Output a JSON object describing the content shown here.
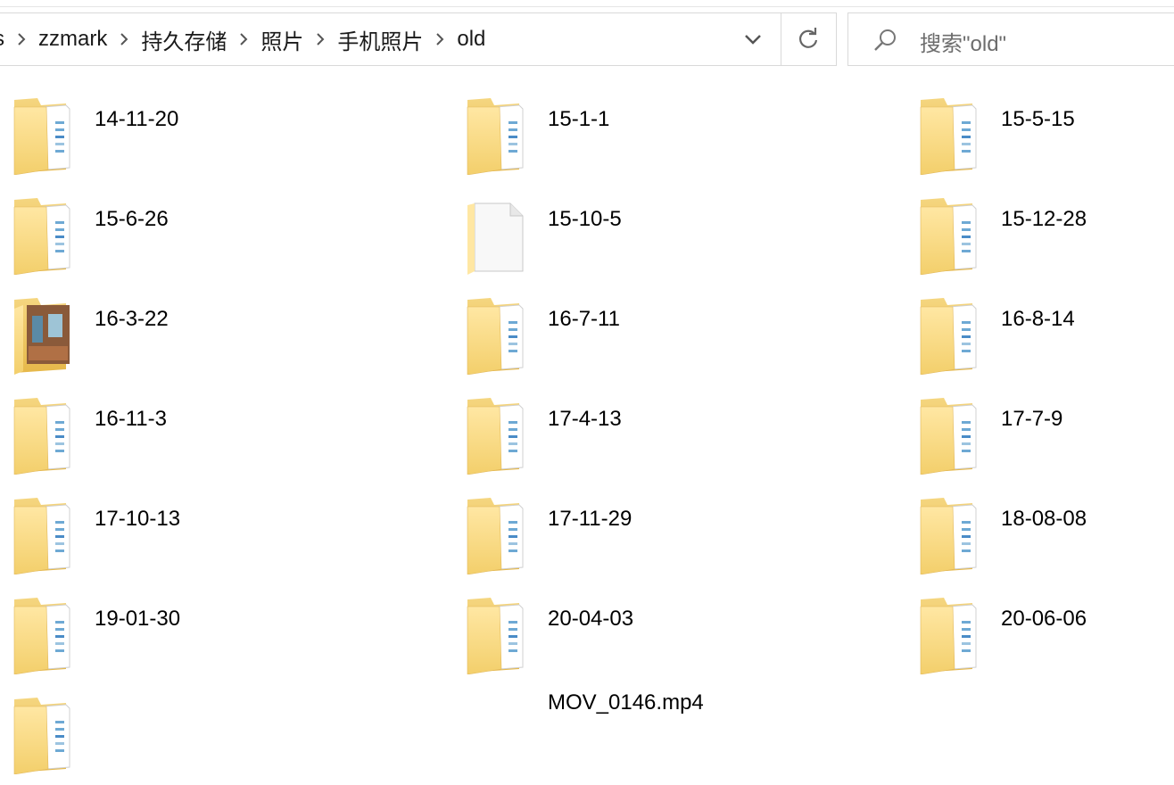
{
  "address_bar": {
    "crumbs": [
      "s",
      "zzmark",
      "持久存储",
      "照片",
      "手机照片",
      "old"
    ]
  },
  "search": {
    "placeholder": "搜索\"old\""
  },
  "items": [
    {
      "name": "14-11-20",
      "icon": "folder-icon"
    },
    {
      "name": "15-1-1",
      "icon": "folder-icon"
    },
    {
      "name": "15-5-15",
      "icon": "folder-icon"
    },
    {
      "name": "15-6-26",
      "icon": "folder-icon"
    },
    {
      "name": "15-10-5",
      "icon": "file-icon"
    },
    {
      "name": "15-12-28",
      "icon": "folder-icon"
    },
    {
      "name": "16-3-22",
      "icon": "photo-folder-icon"
    },
    {
      "name": "16-7-11",
      "icon": "folder-icon"
    },
    {
      "name": "16-8-14",
      "icon": "folder-icon"
    },
    {
      "name": "16-11-3",
      "icon": "folder-icon"
    },
    {
      "name": "17-4-13",
      "icon": "folder-icon"
    },
    {
      "name": "17-7-9",
      "icon": "folder-icon"
    },
    {
      "name": "17-10-13",
      "icon": "folder-icon"
    },
    {
      "name": "17-11-29",
      "icon": "folder-icon"
    },
    {
      "name": "18-08-08",
      "icon": "folder-icon"
    },
    {
      "name": "19-01-30",
      "icon": "folder-icon"
    },
    {
      "name": "20-04-03",
      "icon": "folder-icon"
    },
    {
      "name": "20-06-06",
      "icon": "folder-icon"
    },
    {
      "name": "",
      "icon": "folder-icon"
    },
    {
      "name": "MOV_0146.mp4",
      "icon": "video-file-icon"
    }
  ]
}
